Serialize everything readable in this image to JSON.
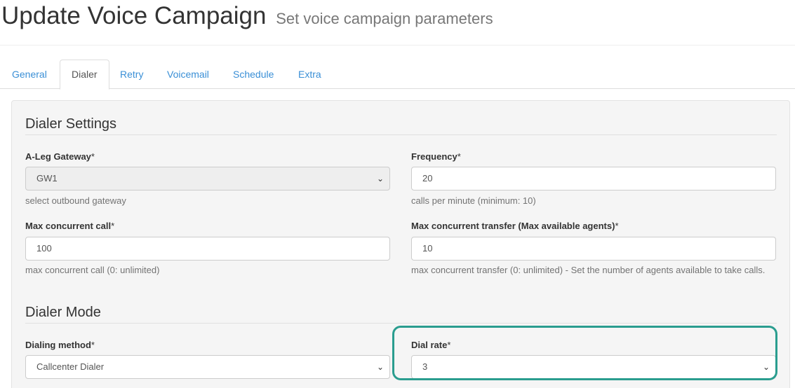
{
  "header": {
    "title": "Update Voice Campaign",
    "subtitle": "Set voice campaign parameters"
  },
  "tabs": [
    {
      "label": "General"
    },
    {
      "label": "Dialer"
    },
    {
      "label": "Retry"
    },
    {
      "label": "Voicemail"
    },
    {
      "label": "Schedule"
    },
    {
      "label": "Extra"
    }
  ],
  "active_tab": "Dialer",
  "dialer_settings": {
    "title": "Dialer Settings",
    "gateway": {
      "label": "A-Leg Gateway",
      "value": "GW1",
      "help": "select outbound gateway"
    },
    "frequency": {
      "label": "Frequency",
      "value": "20",
      "help": "calls per minute (minimum: 10)"
    },
    "max_call": {
      "label": "Max concurrent call",
      "value": "100",
      "help": "max concurrent call (0: unlimited)"
    },
    "max_transfer": {
      "label": "Max concurrent transfer (Max available agents)",
      "value": "10",
      "help": "max concurrent transfer (0: unlimited) - Set the number of agents available to take calls."
    }
  },
  "dialer_mode": {
    "title": "Dialer Mode",
    "method": {
      "label": "Dialing method",
      "value": "Callcenter Dialer"
    },
    "rate": {
      "label": "Dial rate",
      "value": "3"
    }
  },
  "required_marker": "*",
  "select_chevron": "⌄",
  "colors": {
    "link": "#3a8fd6",
    "highlight": "#2a9d8f"
  }
}
